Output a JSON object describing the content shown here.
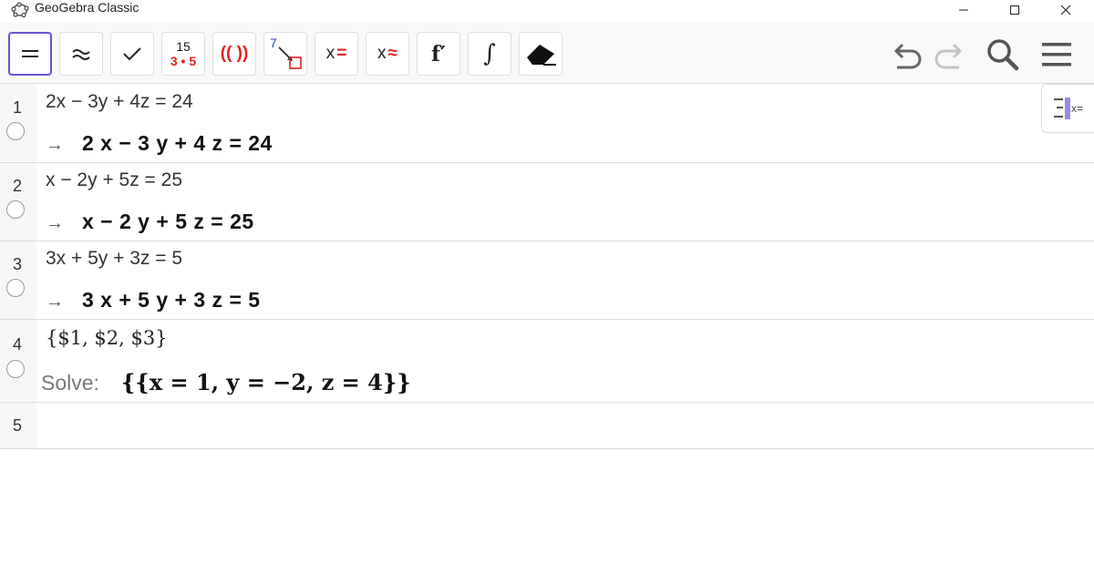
{
  "window": {
    "title": "GeoGebra Classic"
  },
  "toolbar": {
    "numeric_fraction_top": "15",
    "numeric_fraction_bottom": "3 • 5",
    "keep_input_label": "(( ))",
    "substitute_number": "7",
    "solve_label": "x",
    "solve_suffix": "=",
    "nsolve_label": "x",
    "nsolve_suffix": "≈",
    "derivative_label": "f′",
    "integral_label": "∫"
  },
  "rows": [
    {
      "number": "1",
      "input": "2x − 3y + 4z  =  24",
      "output": "2 x − 3 y + 4 z = 24"
    },
    {
      "number": "2",
      "input": "x − 2y + 5z  =  25",
      "output": "x − 2 y + 5 z = 25"
    },
    {
      "number": "3",
      "input": "3x + 5y + 3z  =  5",
      "output": "3 x + 5 y + 3 z = 5"
    },
    {
      "number": "4",
      "input": "{$1, $2, $3}",
      "solve_label": "Solve:",
      "output": "{{x = 1, y = −2, z = 4}}"
    },
    {
      "number": "5"
    }
  ],
  "icons": {
    "arrow": "→"
  },
  "view_toggle": {
    "label": "x="
  },
  "colors": {
    "accent": "#6557d2",
    "red": "#e02020",
    "blue": "#2040d0"
  }
}
